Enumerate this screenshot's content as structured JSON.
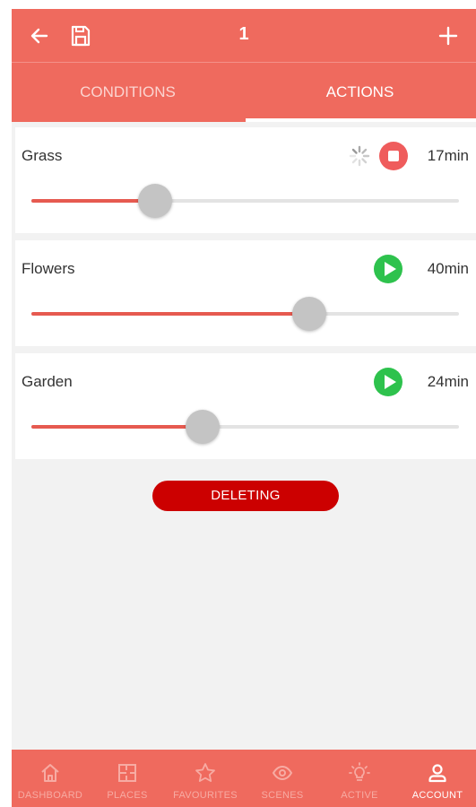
{
  "header": {
    "title": "1",
    "back_icon": "arrow-left-icon",
    "save_icon": "floppy-disk-icon",
    "add_icon": "plus-icon"
  },
  "tabs": [
    {
      "label": "CONDITIONS",
      "active": false
    },
    {
      "label": "ACTIONS",
      "active": true
    }
  ],
  "zones": [
    {
      "name": "Grass",
      "duration": "17min",
      "state": "running",
      "control_icon": "stop-icon",
      "loading": true,
      "level": 0.29
    },
    {
      "name": "Flowers",
      "duration": "40min",
      "state": "idle",
      "control_icon": "play-icon",
      "loading": false,
      "level": 0.65
    },
    {
      "name": "Garden",
      "duration": "24min",
      "state": "idle",
      "control_icon": "play-icon",
      "loading": false,
      "level": 0.4
    }
  ],
  "deleting_button": {
    "label": "DELETING"
  },
  "bottom_nav": [
    {
      "label": "DASHBOARD",
      "icon": "home-icon",
      "active": false
    },
    {
      "label": "PLACES",
      "icon": "floorplan-icon",
      "active": false
    },
    {
      "label": "FAVOURITES",
      "icon": "star-icon",
      "active": false
    },
    {
      "label": "SCENES",
      "icon": "eye-icon",
      "active": false
    },
    {
      "label": "ACTIVE",
      "icon": "lightbulb-icon",
      "active": false
    },
    {
      "label": "ACCOUNT",
      "icon": "user-icon",
      "active": true
    }
  ],
  "colors": {
    "accent": "#ef6a5e",
    "slider_fill": "#e65a50",
    "play": "#2ec24d",
    "stop": "#ef5c5c",
    "deleting": "#cc0000",
    "background": "#f2f2f2"
  }
}
